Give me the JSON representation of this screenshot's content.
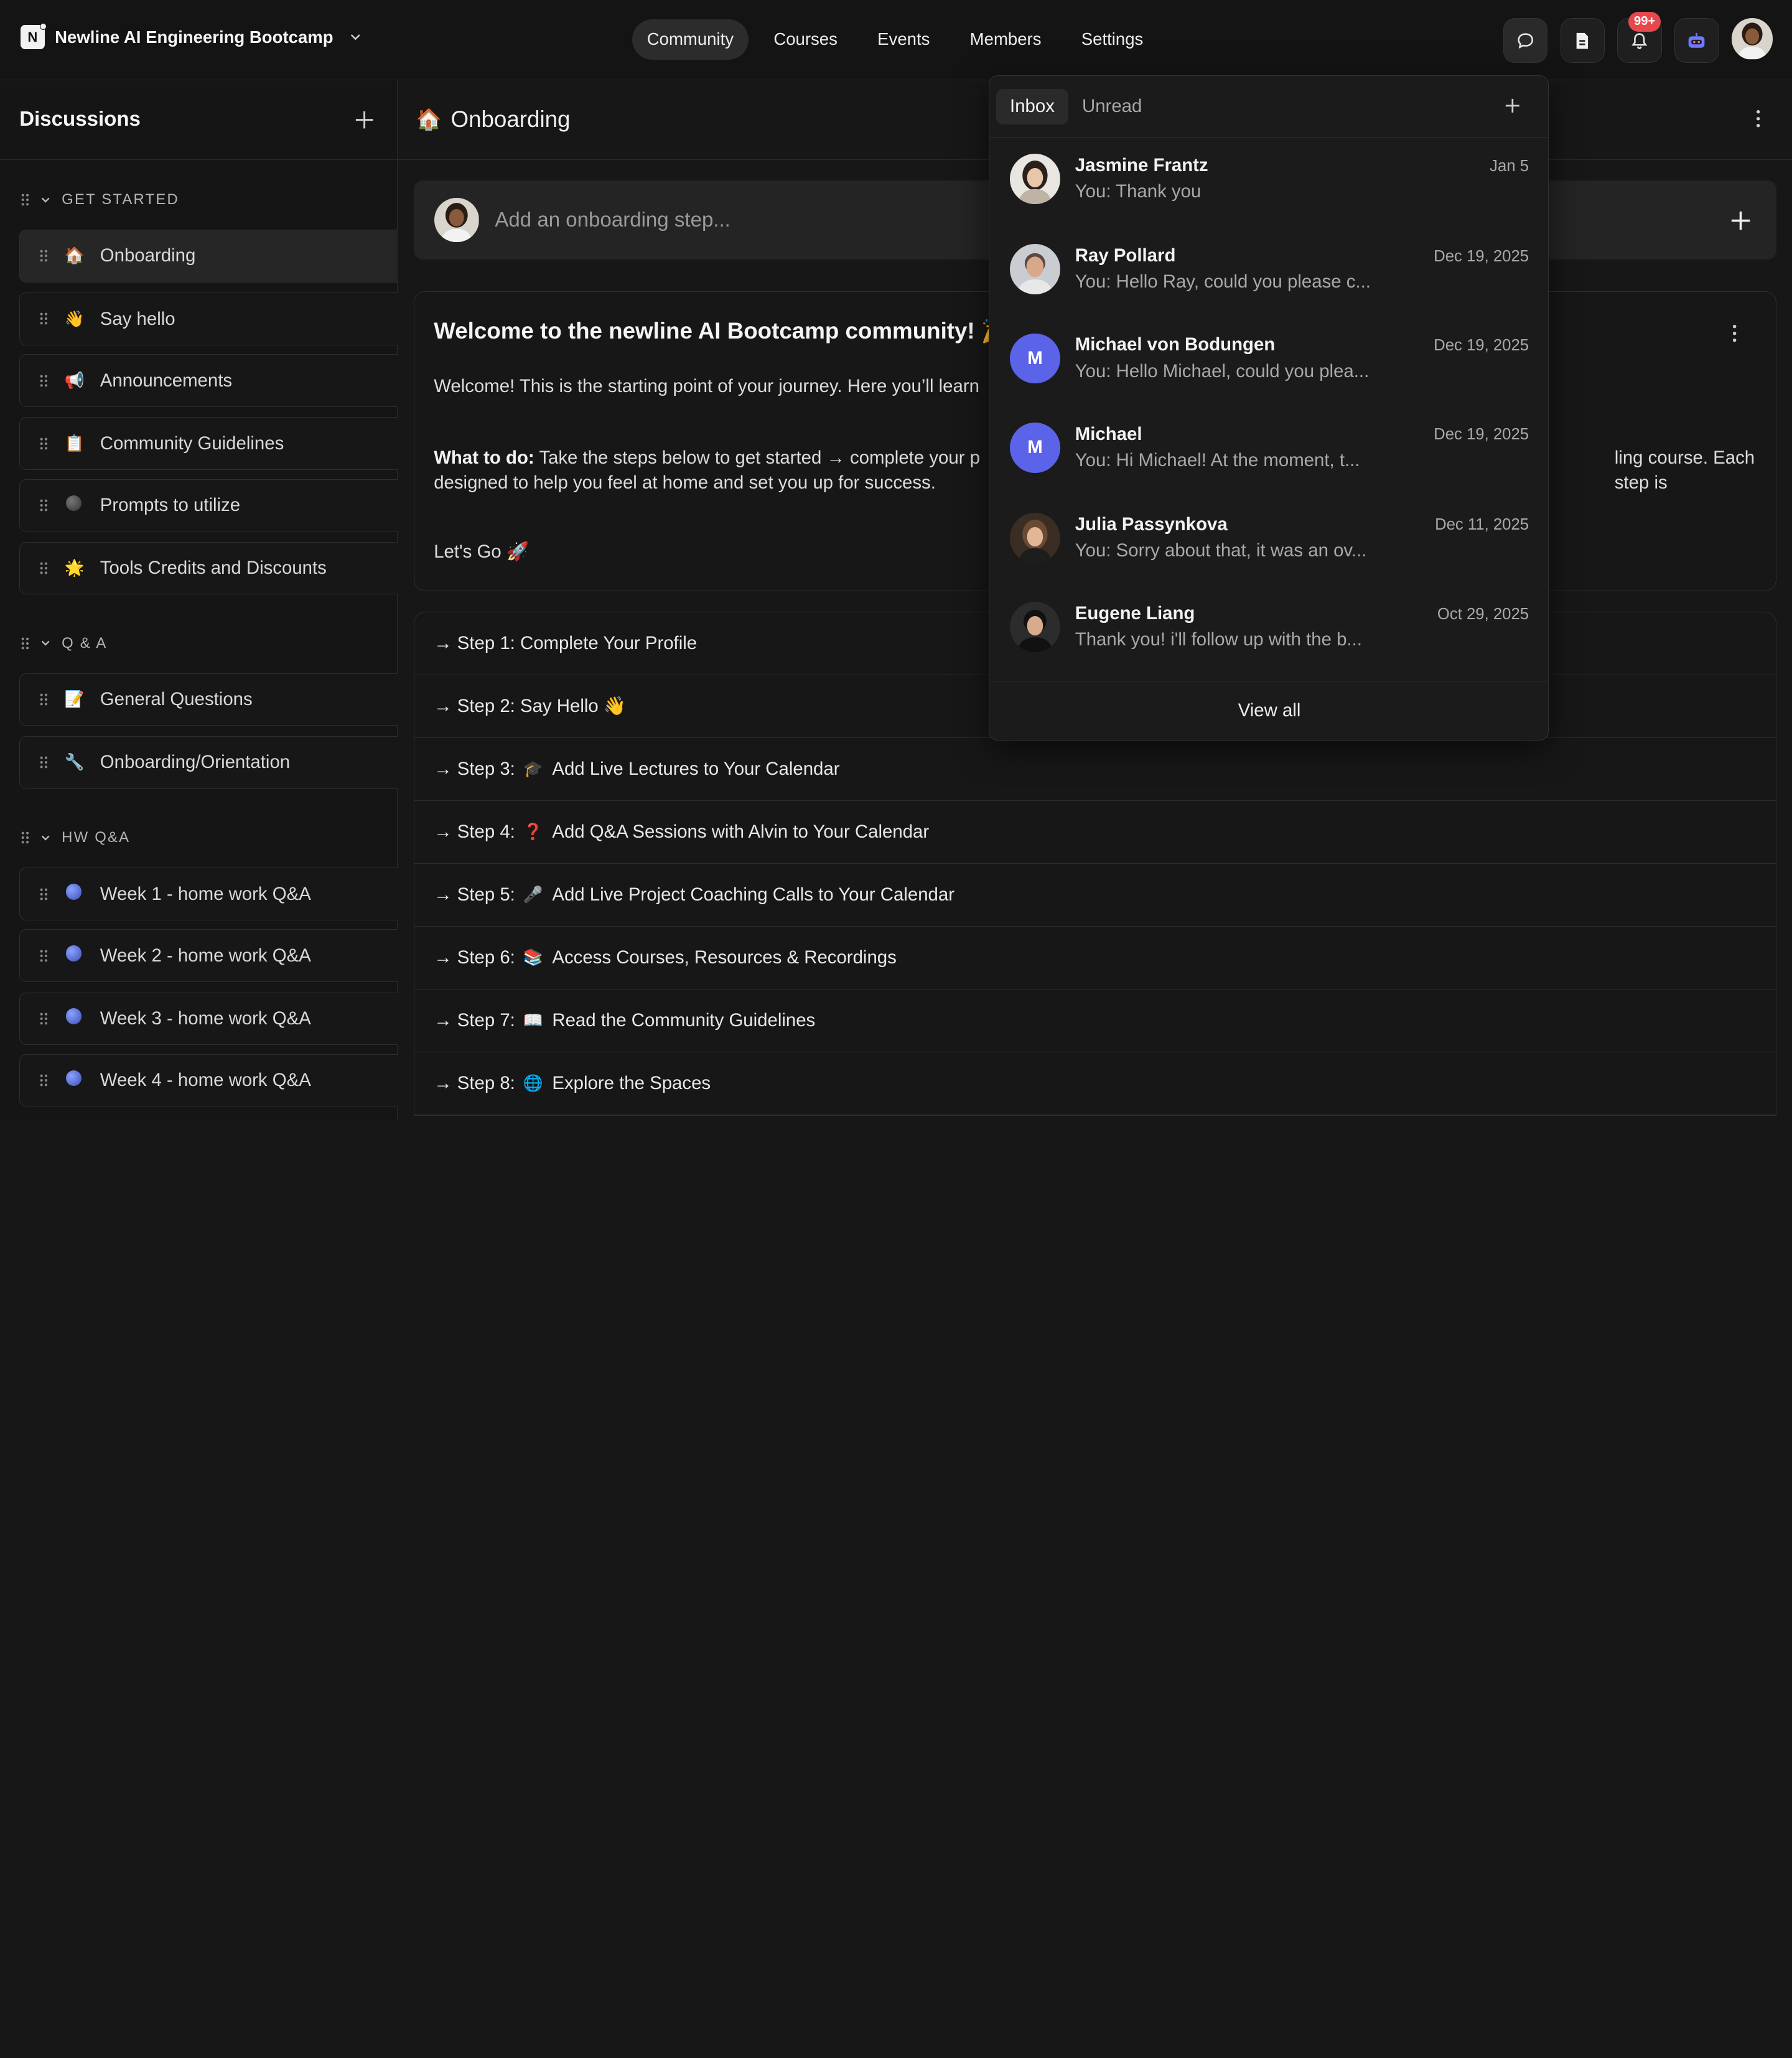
{
  "topbar": {
    "brand": "Newline AI Engineering Bootcamp",
    "brand_logo_text": "N",
    "nav": [
      "Community",
      "Courses",
      "Events",
      "Members",
      "Settings"
    ],
    "active_nav": "Community",
    "notification_badge": "99+"
  },
  "sidebar": {
    "title": "Discussions",
    "groups": [
      {
        "name": "GET STARTED",
        "items": [
          {
            "icon": "🏠",
            "label": "Onboarding",
            "active": true
          },
          {
            "icon": "👋",
            "label": "Say hello"
          },
          {
            "icon": "📢",
            "label": "Announcements"
          },
          {
            "icon": "📋",
            "label": "Community Guidelines"
          },
          {
            "icon": "gray-dot",
            "label": "Prompts to utilize"
          },
          {
            "icon": "🌟",
            "label": "Tools Credits and Discounts"
          }
        ]
      },
      {
        "name": "Q & A",
        "items": [
          {
            "icon": "📝",
            "label": "General Questions"
          },
          {
            "icon": "🔧",
            "label": "Onboarding/Orientation"
          }
        ]
      },
      {
        "name": "HW Q&A",
        "items": [
          {
            "icon": "blue-dot",
            "label": "Week 1 - home work Q&A"
          },
          {
            "icon": "blue-dot",
            "label": "Week 2 - home work Q&A"
          },
          {
            "icon": "blue-dot",
            "label": "Week 3 - home work Q&A"
          },
          {
            "icon": "blue-dot",
            "label": "Week 4 - home work Q&A"
          }
        ]
      }
    ]
  },
  "main": {
    "title_icon": "🏠",
    "title": "Onboarding",
    "add_step_placeholder": "Add an onboarding step...",
    "welcome": {
      "heading": "Welcome to the newline AI Bootcamp community! 🎉",
      "p1": "Welcome! This is the starting point of your journey. Here you’ll learn",
      "p2_bold": "What to do:",
      "p2_text": " Take the steps below to get started → complete your p",
      "p2_tail": "ling course. Each step is",
      "p2_line2": "designed to help you feel at home and set you up for success.",
      "p3": "Let's Go  🚀"
    },
    "steps": [
      {
        "prefix": "→ Step 1:",
        "emoji": "",
        "text": "Complete Your Profile"
      },
      {
        "prefix": "→ Step 2:",
        "emoji": "",
        "text": "Say Hello 👋"
      },
      {
        "prefix": "→ Step 3:",
        "emoji": "🎓",
        "text": "Add Live Lectures to Your Calendar"
      },
      {
        "prefix": "→ Step 4:",
        "emoji": "❓",
        "text": "Add Q&A Sessions with Alvin to Your Calendar"
      },
      {
        "prefix": "→ Step 5:",
        "emoji": "🎤",
        "text": "Add Live Project Coaching Calls to Your Calendar"
      },
      {
        "prefix": "→ Step 6:",
        "emoji": "📚",
        "text": "Access Courses, Resources & Recordings"
      },
      {
        "prefix": "→ Step 7:",
        "emoji": "📖",
        "text": "Read the Community Guidelines"
      },
      {
        "prefix": "→ Step 8:",
        "emoji": "🌐",
        "text": "Explore the Spaces"
      }
    ]
  },
  "inbox": {
    "tabs": [
      "Inbox",
      "Unread"
    ],
    "active_tab": "Inbox",
    "messages": [
      {
        "name": "Jasmine Frantz",
        "preview": "You: Thank you",
        "date": "Jan 5",
        "avatar": "photo"
      },
      {
        "name": "Ray Pollard",
        "preview": "You: Hello Ray, could you please c...",
        "date": "Dec 19, 2025",
        "avatar": "photo"
      },
      {
        "name": "Michael von Bodungen",
        "preview": "You: Hello Michael, could you plea...",
        "date": "Dec 19, 2025",
        "avatar": "M"
      },
      {
        "name": "Michael",
        "preview": "You: Hi Michael! At the moment, t...",
        "date": "Dec 19, 2025",
        "avatar": "M"
      },
      {
        "name": "Julia Passynkova",
        "preview": "You: Sorry about that, it was an ov...",
        "date": "Dec 11, 2025",
        "avatar": "photo"
      },
      {
        "name": "Eugene Liang",
        "preview": "Thank you! i'll follow up with the b...",
        "date": "Oct 29, 2025",
        "avatar": "photo"
      }
    ],
    "footer": "View all"
  },
  "colors": {
    "accent_initial_avatar": "#5b63e8",
    "badge": "#e5484d"
  }
}
